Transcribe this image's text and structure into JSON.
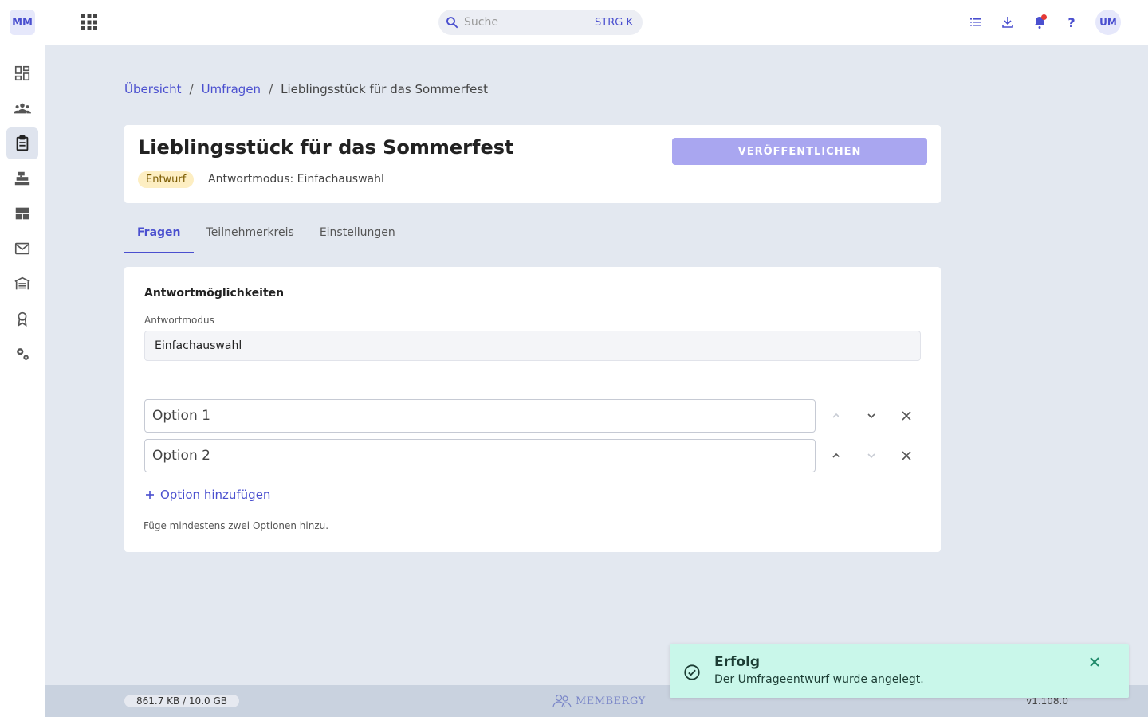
{
  "app": {
    "logo_text": "MM",
    "brand_name": "MEMBERGY",
    "accent": "#4a4fcf"
  },
  "sidebar": {
    "items": [
      {
        "icon": "dashboard-icon",
        "active": false
      },
      {
        "icon": "members-icon",
        "active": false
      },
      {
        "icon": "clipboard-icon",
        "active": true
      },
      {
        "icon": "cash-register-icon",
        "active": false
      },
      {
        "icon": "table-layout-icon",
        "active": false
      },
      {
        "icon": "mail-icon",
        "active": false
      },
      {
        "icon": "warehouse-icon",
        "active": false
      },
      {
        "icon": "award-icon",
        "active": false
      },
      {
        "icon": "settings-icon",
        "active": false
      }
    ]
  },
  "topbar": {
    "search_placeholder": "Suche",
    "search_shortcut": "STRG K",
    "help_label": "?",
    "avatar_initials": "UM"
  },
  "breadcrumb": {
    "items": [
      "Übersicht",
      "Umfragen"
    ],
    "separator": "/",
    "current": "Lieblingsstück für das Sommerfest"
  },
  "header": {
    "title": "Lieblingsstück für das Sommerfest",
    "publish_label": "VERÖFFENTLICHEN",
    "status_badge": "Entwurf",
    "mode_label": "Antwortmodus:",
    "mode_value": "Einfachauswahl"
  },
  "tabs": [
    {
      "label": "Fragen",
      "active": true
    },
    {
      "label": "Teilnehmerkreis",
      "active": false
    },
    {
      "label": "Einstellungen",
      "active": false
    }
  ],
  "answers": {
    "section_title": "Antwortmöglichkeiten",
    "mode_field_label": "Antwortmodus",
    "mode_field_value": "Einfachauswahl",
    "options": [
      {
        "value": "Option 1",
        "can_move_up": false,
        "can_move_down": true
      },
      {
        "value": "Option 2",
        "can_move_up": true,
        "can_move_down": false
      }
    ],
    "add_option_label": "Option hinzufügen",
    "hint": "Füge mindestens zwei Optionen hinzu."
  },
  "footer": {
    "storage": "861.7 KB / 10.0 GB",
    "version": "v1.108.0"
  },
  "toast": {
    "title": "Erfolg",
    "message": "Der Umfrageentwurf wurde angelegt.",
    "color": "#c9f7ea"
  }
}
